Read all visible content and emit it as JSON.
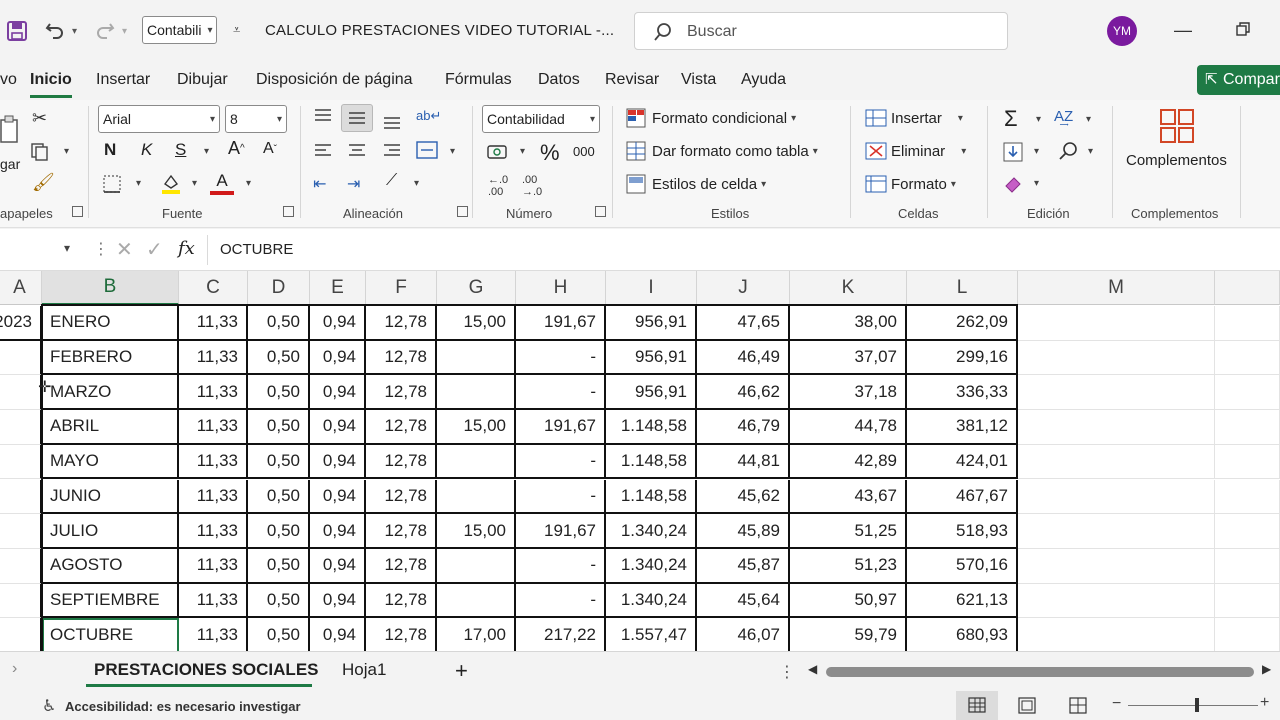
{
  "titlebar": {
    "font_box_value": "Contabili",
    "doc_title": "CALCULO PRESTACIONES VIDEO TUTORIAL  -...",
    "search_placeholder": "Buscar",
    "avatar_initials": "YM"
  },
  "tabs": {
    "partial_first": "vo",
    "items": [
      "Inicio",
      "Insertar",
      "Dibujar",
      "Disposición de página",
      "Fórmulas",
      "Datos",
      "Revisar",
      "Vista",
      "Ayuda"
    ],
    "active": "Inicio",
    "share_label": "Compar"
  },
  "ribbon": {
    "groups": {
      "clipboard": "apapeles",
      "font": "Fuente",
      "alignment": "Alineación",
      "number": "Número",
      "styles": "Estilos",
      "cells": "Celdas",
      "editing": "Edición",
      "addins": "Complementos"
    },
    "paste_label": "gar",
    "font_name": "Arial",
    "font_size": "8",
    "bold": "N",
    "italic": "K",
    "underline": "S",
    "number_format": "Contabilidad",
    "percent": "%",
    "thousands": "000",
    "styles": {
      "conditional": "Formato condicional",
      "as_table": "Dar formato como tabla",
      "cell_styles": "Estilos de celda"
    },
    "cells": {
      "insert": "Insertar",
      "delete": "Eliminar",
      "format": "Formato"
    },
    "addins_button": "Complementos"
  },
  "formula_bar": {
    "fx": "fx",
    "content": "OCTUBRE"
  },
  "grid": {
    "columns": [
      "A",
      "B",
      "C",
      "D",
      "E",
      "F",
      "G",
      "H",
      "I",
      "J",
      "K",
      "L",
      "M"
    ],
    "selected_column": "B",
    "rows": [
      [
        "2023",
        "ENERO",
        "11,33",
        "0,50",
        "0,94",
        "12,78",
        "15,00",
        "191,67",
        "956,91",
        "47,65",
        "38,00",
        "262,09"
      ],
      [
        "",
        "FEBRERO",
        "11,33",
        "0,50",
        "0,94",
        "12,78",
        "",
        "-",
        "956,91",
        "46,49",
        "37,07",
        "299,16"
      ],
      [
        "",
        "MARZO",
        "11,33",
        "0,50",
        "0,94",
        "12,78",
        "",
        "-",
        "956,91",
        "46,62",
        "37,18",
        "336,33"
      ],
      [
        "",
        "ABRIL",
        "11,33",
        "0,50",
        "0,94",
        "12,78",
        "15,00",
        "191,67",
        "1.148,58",
        "46,79",
        "44,78",
        "381,12"
      ],
      [
        "",
        "MAYO",
        "11,33",
        "0,50",
        "0,94",
        "12,78",
        "",
        "-",
        "1.148,58",
        "44,81",
        "42,89",
        "424,01"
      ],
      [
        "",
        "JUNIO",
        "11,33",
        "0,50",
        "0,94",
        "12,78",
        "",
        "-",
        "1.148,58",
        "45,62",
        "43,67",
        "467,67"
      ],
      [
        "",
        "JULIO",
        "11,33",
        "0,50",
        "0,94",
        "12,78",
        "15,00",
        "191,67",
        "1.340,24",
        "45,89",
        "51,25",
        "518,93"
      ],
      [
        "",
        "AGOSTO",
        "11,33",
        "0,50",
        "0,94",
        "12,78",
        "",
        "-",
        "1.340,24",
        "45,87",
        "51,23",
        "570,16"
      ],
      [
        "",
        "SEPTIEMBRE",
        "11,33",
        "0,50",
        "0,94",
        "12,78",
        "",
        "-",
        "1.340,24",
        "45,64",
        "50,97",
        "621,13"
      ],
      [
        "",
        "OCTUBRE",
        "11,33",
        "0,50",
        "0,94",
        "12,78",
        "17,00",
        "217,22",
        "1.557,47",
        "46,07",
        "59,79",
        "680,93"
      ]
    ]
  },
  "sheets": {
    "active": "PRESTACIONES SOCIALES",
    "other": "Hoja1",
    "add": "+"
  },
  "status": {
    "accessibility": "Accesibilidad: es necesario investigar"
  },
  "colors": {
    "accent_green": "#1e7a45",
    "avatar_purple": "#7a1a9e",
    "save_purple": "#7b3fa0"
  }
}
